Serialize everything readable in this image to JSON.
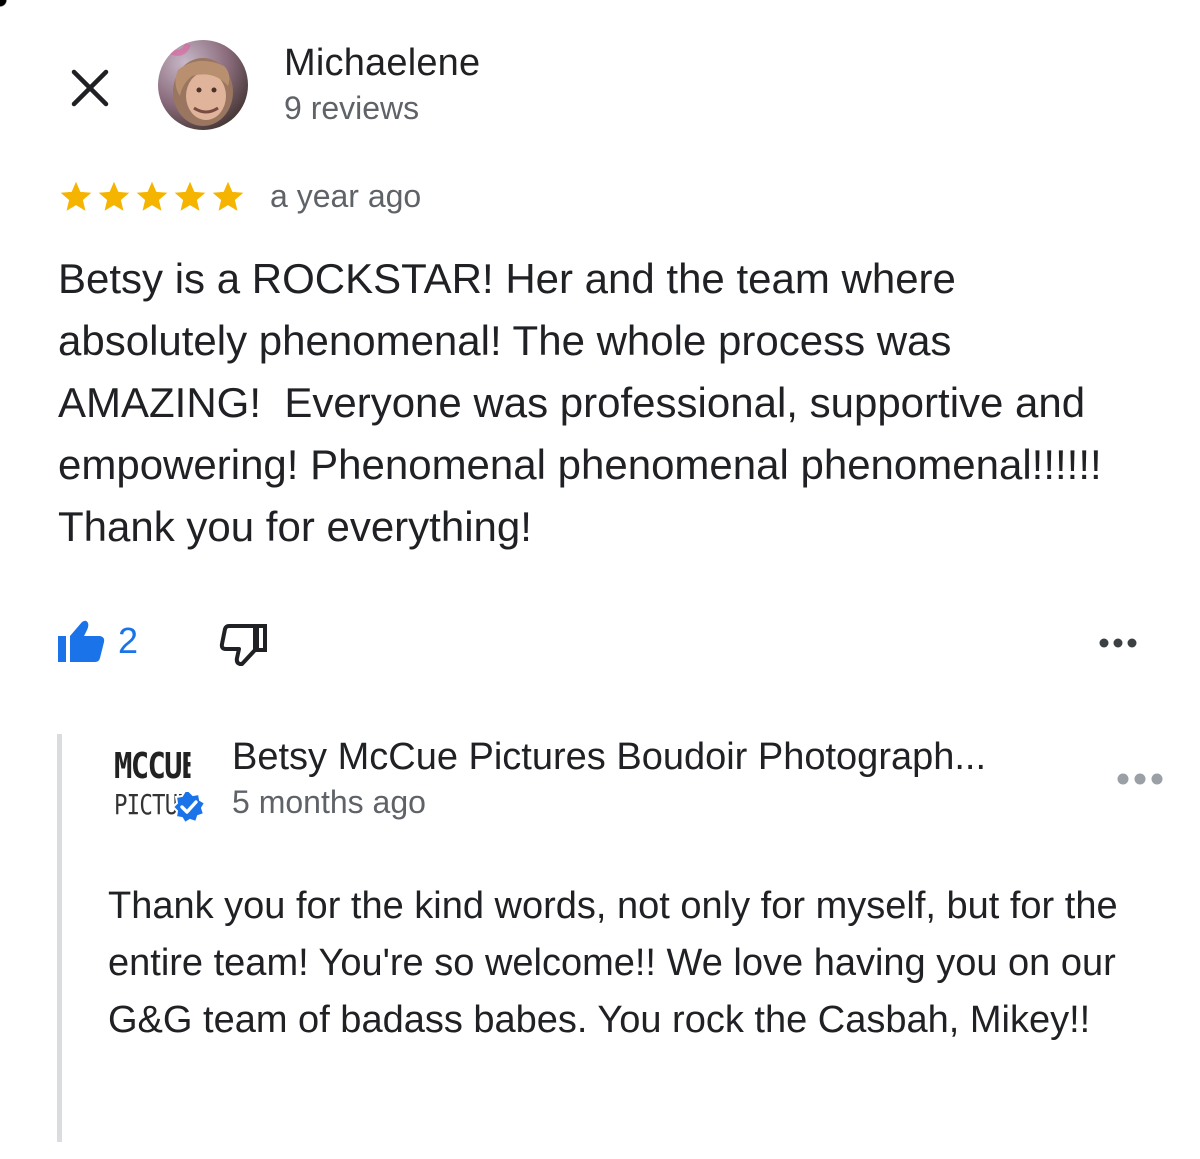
{
  "header": {
    "close_icon": "close-icon",
    "reviewer": {
      "name": "Michaelene",
      "review_count": "9 reviews"
    }
  },
  "review": {
    "rating": 5,
    "rating_max": 5,
    "time": "a year ago",
    "text": "Betsy is a ROCKSTAR! Her and the team where absolutely phenomenal! The whole process was AMAZING!  Everyone was professional, supportive and empowering! Phenomenal phenomenal phenomenal!!!!!! Thank you for everything!",
    "likes": "2",
    "colors": {
      "star": "#f4b400",
      "like": "#1a73e8",
      "secondary_text": "#5f6368"
    }
  },
  "owner_reply": {
    "logo_line1": "MCCUE",
    "logo_line2": "PICTURES",
    "name": "Betsy McCue Pictures Boudoir Photograph...",
    "time": "5 months ago",
    "text": "Thank you for the kind words, not only for myself, but for the entire team! You're so welcome!! We love having you on our G&G team of badass babes. You rock the Casbah, Mikey!!"
  }
}
